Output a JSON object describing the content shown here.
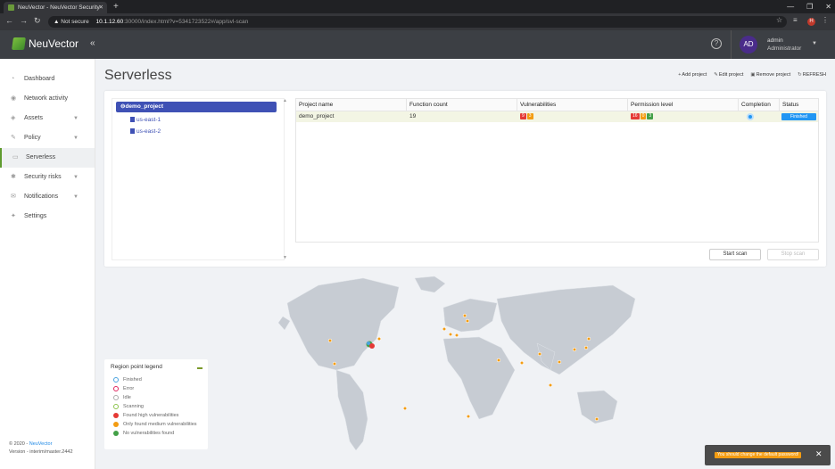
{
  "browser": {
    "tab_title": "NeuVector - NeuVector Security",
    "tab_close": "✕",
    "new_tab": "+",
    "not_secure": "Not secure",
    "url_host": "10.1.12.60",
    "url_path": ":30000/index.html?v=5341723522#/app/svl-scan",
    "ext_h": "H"
  },
  "header": {
    "logo_text": "NeuVector",
    "collapse": "«",
    "help": "?",
    "avatar": "AD",
    "user_name": "admin",
    "user_role": "Administrator"
  },
  "sidebar": {
    "items": [
      {
        "label": "Dashboard"
      },
      {
        "label": "Network activity"
      },
      {
        "label": "Assets"
      },
      {
        "label": "Policy"
      },
      {
        "label": "Serverless"
      },
      {
        "label": "Security risks"
      },
      {
        "label": "Notifications"
      },
      {
        "label": "Settings"
      }
    ],
    "footer_copy": "© 2020 -",
    "footer_link": "NeuVector",
    "footer_version": "Version - interim/master.2442"
  },
  "page": {
    "title": "Serverless",
    "add_project": "Add project",
    "edit_project": "Edit project",
    "remove_project": "Remove project",
    "refresh": "REFRESH"
  },
  "tree": {
    "root": "demo_project",
    "leaves": [
      "us-east-1",
      "us-east-2"
    ]
  },
  "grid": {
    "headers": [
      "Project name",
      "Function count",
      "Vulnerabilities",
      "Permission level",
      "Completion",
      "Status"
    ],
    "rows": [
      {
        "name": "demo_project",
        "count": "19",
        "vuln": [
          "9",
          "3"
        ],
        "perm": [
          "16",
          "0",
          "3"
        ],
        "status": "Finished"
      }
    ]
  },
  "buttons": {
    "start": "Start scan",
    "stop": "Stop scan"
  },
  "legend": {
    "title": "Region point legend",
    "items": [
      {
        "label": "Finished",
        "color": "#4aa3df"
      },
      {
        "label": "Error",
        "color": "#e0245e"
      },
      {
        "label": "Idle",
        "color": "#aaaaaa"
      },
      {
        "label": "Scanning",
        "color": "#8bc34a"
      },
      {
        "label": "Found high vulnerabilities",
        "color": "#e53935"
      },
      {
        "label": "Only found medium vulnerabilities",
        "color": "#f39c12"
      },
      {
        "label": "No vulnerabilities found",
        "color": "#43a047"
      }
    ]
  },
  "toast": {
    "message": "You should change the default password!",
    "close": "✕"
  }
}
